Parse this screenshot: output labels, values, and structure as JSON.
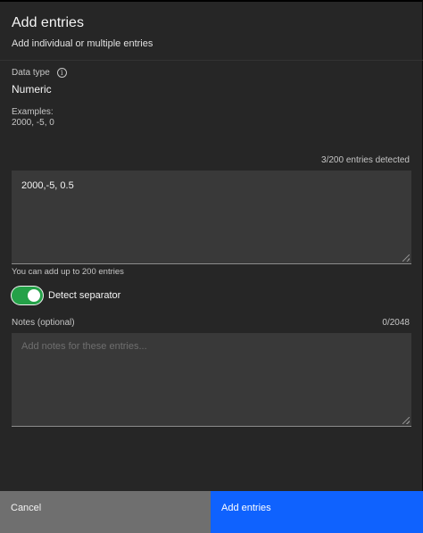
{
  "header": {
    "title": "Add entries",
    "subtitle": "Add individual or multiple entries"
  },
  "data_type": {
    "label": "Data type",
    "info_icon": "information-icon",
    "value": "Numeric"
  },
  "examples": {
    "label": "Examples:",
    "value": "2000, -5, 0"
  },
  "entries": {
    "detected_text": "3/200 entries detected",
    "value": "2000,-5, 0.5",
    "helper_text": "You can add up to 200 entries"
  },
  "separator_toggle": {
    "label": "Detect separator",
    "checked": true,
    "color": "#24a148"
  },
  "notes": {
    "label": "Notes (optional)",
    "count": "0/2048",
    "placeholder": "Add notes for these entries..."
  },
  "footer": {
    "cancel_label": "Cancel",
    "submit_label": "Add entries",
    "primary_color": "#0f62fe"
  }
}
